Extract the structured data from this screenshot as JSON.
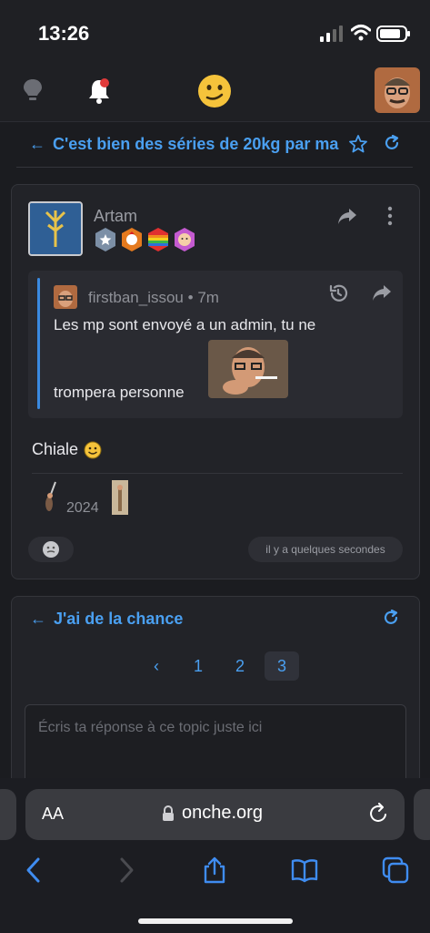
{
  "status": {
    "time": "13:26"
  },
  "topic": {
    "title": "C'est bien des séries de 20kg par ma"
  },
  "post": {
    "author": "Artam",
    "quote": {
      "author": "firstban_issou",
      "age": "7m",
      "line1": "Les mp sont envoyé a un admin, tu ne",
      "line2": "trompera personne"
    },
    "text": "Chiale",
    "signature_year": "2024",
    "timestamp": "il y a quelques secondes"
  },
  "reply": {
    "topic_title": "J'ai de la chance",
    "pages": [
      "1",
      "2",
      "3"
    ],
    "current_page": "3",
    "prev_label": "‹",
    "placeholder": "Écris ta réponse à ce topic juste ici"
  },
  "browser": {
    "aa_label": "AA",
    "url": "onche.org"
  },
  "colors": {
    "accent": "#4a9ff0",
    "background": "#1b1c20",
    "card": "#222328"
  },
  "icons": [
    "bulb-icon",
    "bell-icon",
    "smiley-icon",
    "star-icon",
    "refresh-icon",
    "share-icon",
    "more-icon",
    "history-icon",
    "lock-icon",
    "reload-icon",
    "back-icon",
    "forward-icon",
    "share-sheet-icon",
    "bookmarks-icon",
    "tabs-icon"
  ]
}
